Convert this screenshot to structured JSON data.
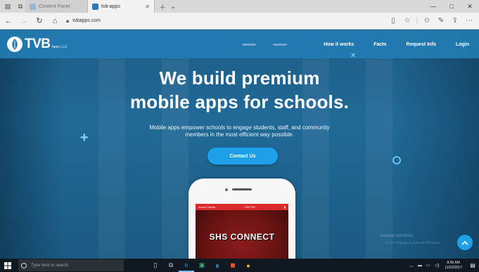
{
  "browser": {
    "tabs": [
      {
        "label": "Content Panel",
        "active": false,
        "favicon_color": "#9bb8d3"
      },
      {
        "label": "tvb-apps",
        "active": true,
        "favicon_color": "#2b7bb9"
      }
    ],
    "address": "tvbapps.com",
    "window_controls": [
      "—",
      "□",
      "✕"
    ]
  },
  "site": {
    "logo_text": "TVB",
    "logo_sub": "Apps LLC",
    "nav": {
      "how_it_works": "How it works",
      "facts": "Facts",
      "request_info": "Request Info",
      "login": "Login"
    },
    "hero": {
      "title_line1": "We build premium",
      "title_line2": "mobile apps for schools.",
      "subtitle_line1": "Mobile apps empower schools to engage students, staff, and community",
      "subtitle_line2": "members in the most efficient way possible.",
      "cta_label": "Contact Us"
    },
    "phone": {
      "status_left": "ooooo Carrier",
      "status_time": "3:59 PM",
      "app_name": "SHS CONNECT"
    },
    "watermark_line1": "Activate Windows",
    "watermark_line2": "Go to Settings to activate Windows."
  },
  "taskbar": {
    "search_placeholder": "Type here to search",
    "clock_time": "8:55 AM",
    "clock_date": "11/22/2017"
  },
  "colors": {
    "nav_bg": "#227cb2",
    "accent": "#1da0e8",
    "hero_bg": "#1d5c87"
  }
}
